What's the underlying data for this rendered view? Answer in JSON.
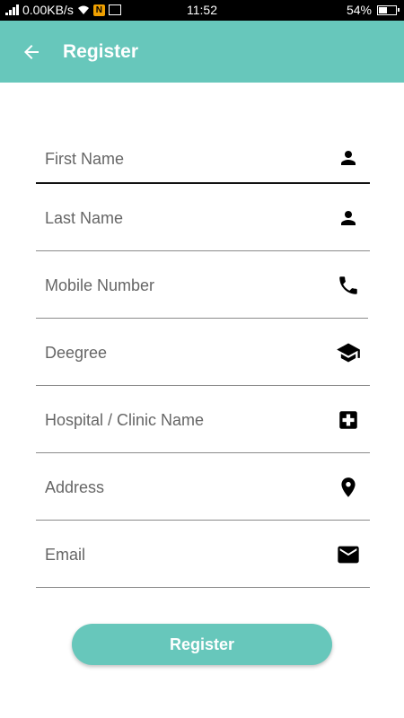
{
  "status_bar": {
    "network_speed": "0.00KB/s",
    "notif_badge": "N",
    "time": "11:52",
    "battery": "54%",
    "battery_level": 0.54
  },
  "app_bar": {
    "title": "Register",
    "back_icon": "arrow-left-icon",
    "background": "#67c7bb"
  },
  "form": {
    "fields": [
      {
        "placeholder": "First Name",
        "value": "",
        "icon": "person-icon"
      },
      {
        "placeholder": "Last Name",
        "value": "",
        "icon": "person-icon"
      },
      {
        "placeholder": "Mobile Number",
        "value": "",
        "icon": "phone-icon"
      },
      {
        "placeholder": "Deegree",
        "value": "",
        "icon": "graduation-cap-icon"
      },
      {
        "placeholder": "Hospital / Clinic Name",
        "value": "",
        "icon": "medical-cross-icon"
      },
      {
        "placeholder": "Address",
        "value": "",
        "icon": "location-pin-icon"
      },
      {
        "placeholder": "Email",
        "value": "",
        "icon": "mail-icon"
      }
    ],
    "submit_label": "Register"
  },
  "colors": {
    "accent": "#67c7bb",
    "text": "#222222",
    "placeholder": "#666666"
  }
}
